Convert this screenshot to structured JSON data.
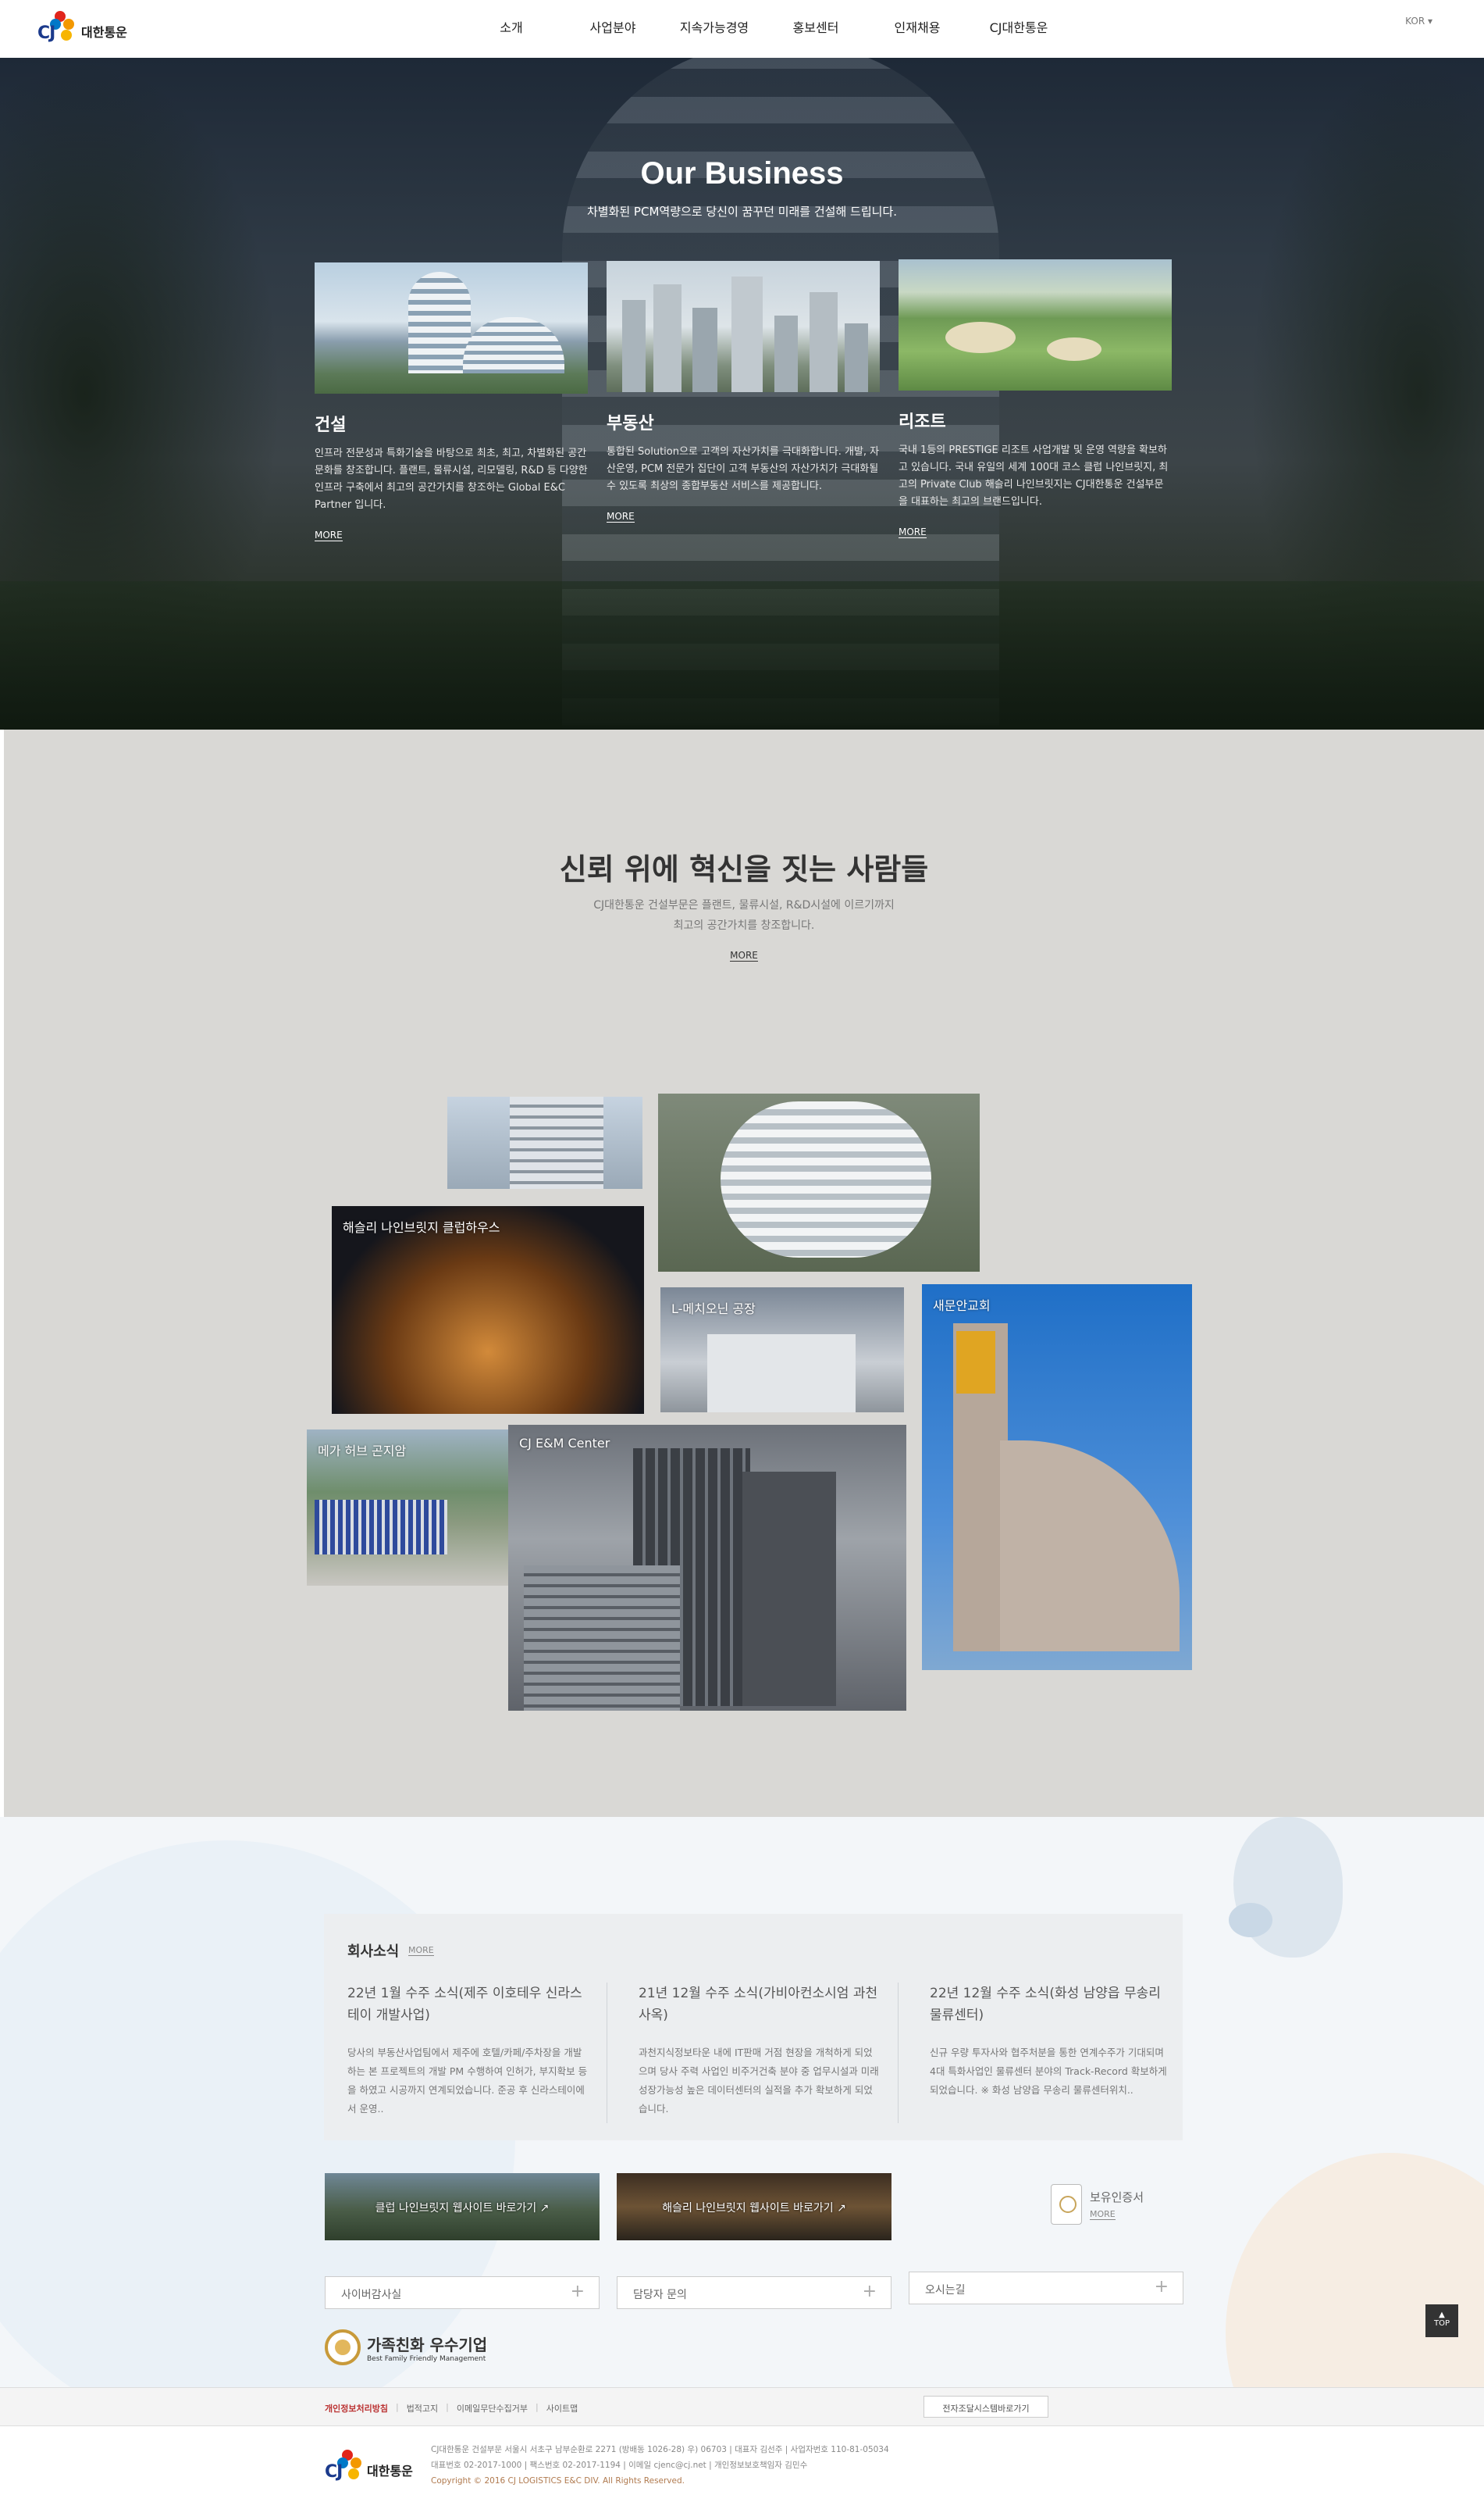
{
  "header": {
    "logo_text": "대한통운",
    "logo_mark": "CJ",
    "nav": [
      "소개",
      "사업분야",
      "지속가능경영",
      "홍보센터",
      "인재채용",
      "CJ대한통운"
    ],
    "language": "KOR ▾"
  },
  "hero": {
    "title": "Our Business",
    "subtitle": "차별화된 PCM역량으로 당신이 꿈꾸던 미래를 건설해 드립니다.",
    "cards": [
      {
        "name": "건설",
        "desc": "인프라 전문성과 특화기술을 바탕으로 최초, 최고, 차별화된 공간문화를 창조합니다. 플랜트, 물류시설, 리모델링, R&D 등 다양한 인프라 구축에서 최고의 공간가치를 창조하는 Global E&C Partner 입니다.",
        "more": "MORE"
      },
      {
        "name": "부동산",
        "desc": "통합된 Solution으로 고객의 자산가치를 극대화합니다. 개발, 자산운영, PCM 전문가 집단이 고객 부동산의 자산가치가 극대화될 수 있도록 최상의 종합부동산 서비스를 제공합니다.",
        "more": "MORE"
      },
      {
        "name": "리조트",
        "desc": "국내 1등의 PRESTIGE 리조트 사업개발 및 운영 역량을 확보하고 있습니다. 국내 유일의 세계 100대 코스 클럽 나인브릿지, 최고의 Private Club 해슬리 나인브릿지는 CJ대한통운 건설부문을 대표하는 최고의 브랜드입니다.",
        "more": "MORE"
      }
    ]
  },
  "people": {
    "title": "신뢰 위에 혁신을 짓는 사람들",
    "desc_line1": "CJ대한통운 건설부문은 플랜트, 물류시설, R&D시설에 이르기까지",
    "desc_line2": "최고의 공간가치를 창조합니다.",
    "more": "MORE",
    "projects": [
      "",
      "",
      "해슬리 나인브릿지 클럽하우스",
      "L-메치오닌 공장",
      "새문안교회",
      "메가 허브 곤지암",
      "CJ E&M Center"
    ]
  },
  "news": {
    "heading": "회사소식",
    "more": "MORE",
    "items": [
      {
        "title": "22년 1월 수주 소식(제주 이호테우 신라스테이 개발사업)",
        "body": "당사의 부동산사업팀에서 제주에 호텔/카페/주차장을 개발하는 본 프로젝트의 개발 PM 수행하여 인허가, 부지확보 등을 하였고 시공까지 연계되었습니다. 준공 후 신라스테이에서 운영.."
      },
      {
        "title": "21년 12월 수주 소식(가비아컨소시엄 과천사옥)",
        "body": "과천지식정보타운 내에 IT판매 거점 현장을 개척하게 되었으며 당사 주력 사업인 비주거건축 분야 중 업무시설과 미래 성장가능성 높은 데이터센터의 실적을 추가 확보하게 되었습니다."
      },
      {
        "title": "22년 12월 수주 소식(화성 남양읍 무송리 물류센터)",
        "body": "신규 우량 투자사와 협주처분을 통한 연계수주가 기대되며 4대 특화사업인 물류센터 분야의 Track-Record 확보하게 되었습니다. ※ 화성 남양읍 무송리 물류센터위치.."
      }
    ],
    "banners": [
      "클럽 나인브릿지 웹사이트 바로가기 ↗",
      "해슬리 나인브릿지 웹사이트 바로가기 ↗"
    ],
    "cert_title": "보유인증서",
    "cert_more": "MORE",
    "selects": [
      "사이버감사실",
      "담당자 문의",
      "오시는길"
    ],
    "family_title": "가족친화 우수기업",
    "family_sub": "Best Family Friendly Management",
    "top": "TOP"
  },
  "footer": {
    "links": [
      "개인정보처리방침",
      "법적고지",
      "이메일무단수집거부",
      "사이트맵"
    ],
    "family_site": "전자조달시스템바로가기",
    "info_line1": "CJ대한통운 건설부문  서울시 서초구 남부순환로 2271 (방배동 1026-28) 우) 06703  |  대표자 김선주  |  사업자번호 110-81-05034",
    "info_line2": "대표번호 02-2017-1000  |  팩스번호 02-2017-1194  |  이메일 cjenc@cj.net  |  개인정보보호책임자 김민수",
    "copyright": "Copyright © 2016 CJ LOGISTICS E&C DIV. All Rights Reserved."
  }
}
